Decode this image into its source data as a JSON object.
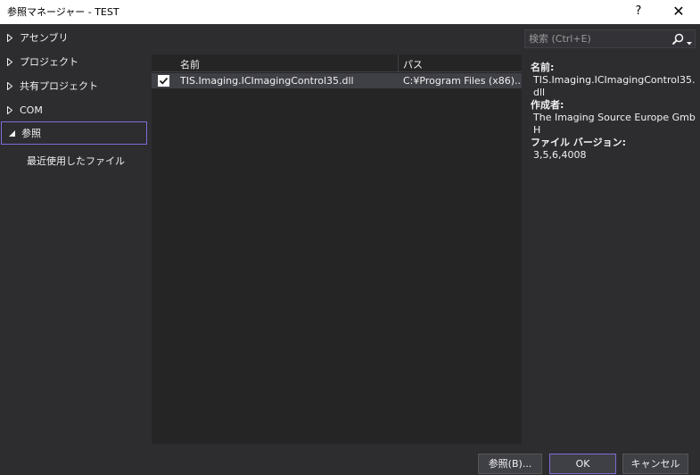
{
  "window": {
    "title": "参照マネージャー - TEST",
    "help_label": "?",
    "close_label": "✕"
  },
  "nav": {
    "items": [
      {
        "label": "アセンブリ",
        "expanded": false
      },
      {
        "label": "プロジェクト",
        "expanded": false
      },
      {
        "label": "共有プロジェクト",
        "expanded": false
      },
      {
        "label": "COM",
        "expanded": false
      },
      {
        "label": "参照",
        "expanded": true,
        "selected": true
      }
    ],
    "sub_item": "最近使用したファイル"
  },
  "search": {
    "placeholder": "検索 (Ctrl+E)",
    "icon": "search-icon"
  },
  "list": {
    "columns": [
      "名前",
      "パス"
    ],
    "rows": [
      {
        "checked": true,
        "name": "TIS.Imaging.ICImagingControl35.dll",
        "path": "C:¥Program Files (x86)..."
      }
    ]
  },
  "details": {
    "name_label": "名前:",
    "name_value": "TIS.Imaging.ICImagingControl35.dll",
    "author_label": "作成者:",
    "author_value": "The Imaging Source Europe GmbH",
    "version_label": "ファイル バージョン:",
    "version_value": "3,5,6,4008"
  },
  "buttons": {
    "browse": "参照(B)...",
    "ok": "OK",
    "cancel": "キャンセル"
  },
  "colors": {
    "background": "#2d2d30",
    "list_background": "#252526",
    "selected_row": "#3f3f46",
    "accent": "#7e6bd6"
  }
}
